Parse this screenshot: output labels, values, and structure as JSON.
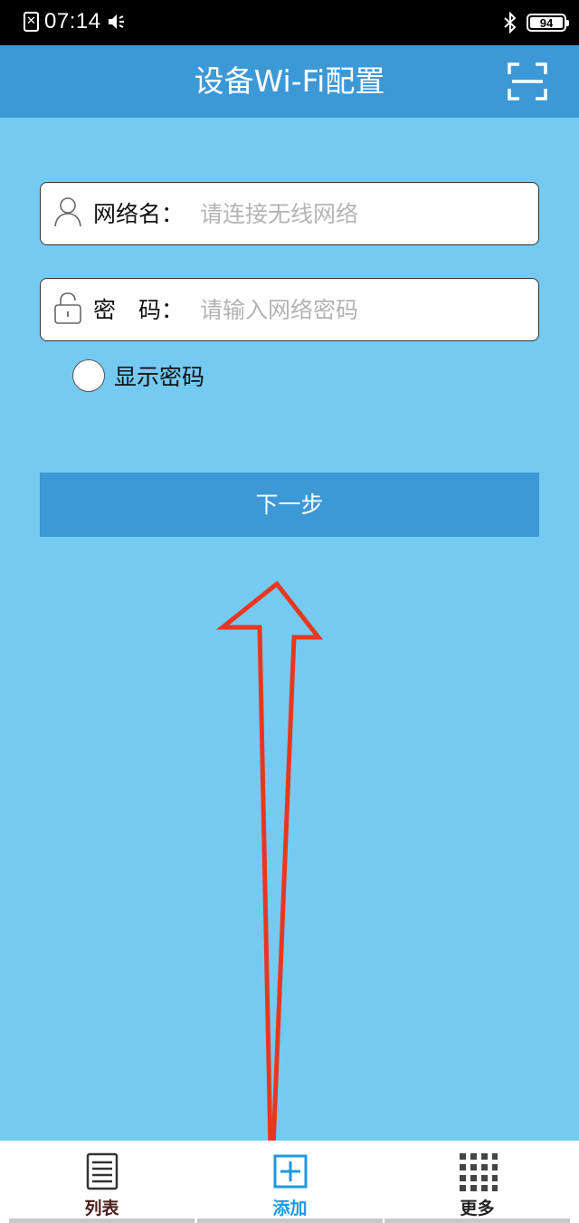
{
  "status_bar": {
    "time": "07:14",
    "sim_icon": "sim-error-icon",
    "sound_icon": "speaker-icon",
    "bluetooth_icon": "bluetooth-icon",
    "battery": "94"
  },
  "header": {
    "title": "设备Wi-Fi配置",
    "scan_icon": "scan-icon"
  },
  "form": {
    "network": {
      "icon": "user-icon",
      "label": "网络名：",
      "placeholder": "请连接无线网络",
      "value": ""
    },
    "password": {
      "icon": "lock-icon",
      "label": "密　码：",
      "placeholder": "请输入网络密码",
      "value": ""
    },
    "show_password": {
      "label": "显示密码",
      "checked": false
    },
    "next_label": "下一步"
  },
  "tabs": [
    {
      "label": "列表",
      "icon": "list-icon",
      "color": "#4a1c1c"
    },
    {
      "label": "添加",
      "icon": "add-icon",
      "color": "#1e9ae0",
      "active": true
    },
    {
      "label": "更多",
      "icon": "grid-icon",
      "color": "#222222"
    }
  ],
  "colors": {
    "background": "#75caf2",
    "header": "#3d98d6",
    "button": "#3d98d6",
    "annotation_arrow": "#e8371f"
  }
}
